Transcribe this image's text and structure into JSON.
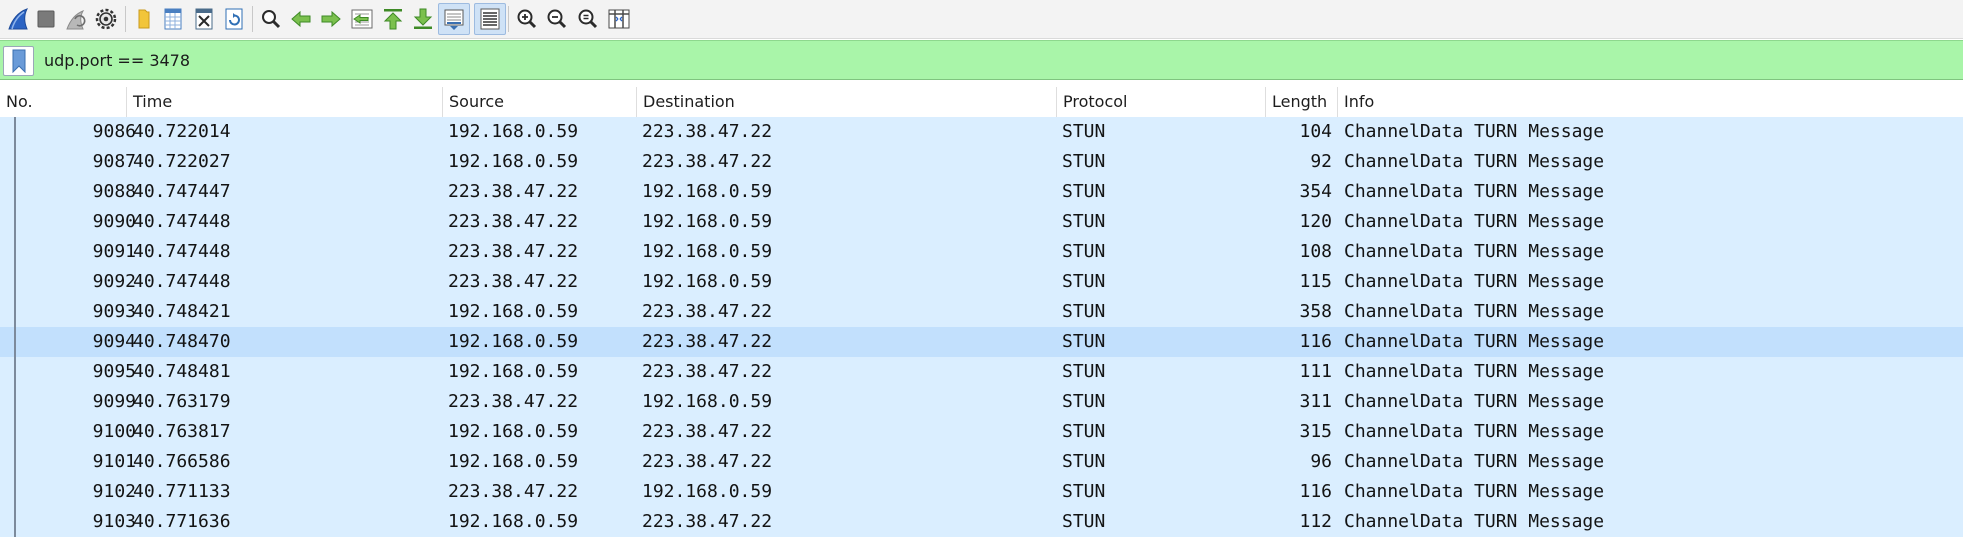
{
  "toolbar": {
    "buttons": [
      {
        "name": "start-capture-button",
        "icon": "shark-fin-icon",
        "color": "#2b63c3"
      },
      {
        "name": "stop-capture-button",
        "icon": "stop-square-icon",
        "color": "#7a7a7a"
      },
      {
        "name": "restart-capture-button",
        "icon": "restart-fin-icon",
        "color": "#9a9a9a"
      },
      {
        "name": "capture-options-button",
        "icon": "gear-icon",
        "color": "#333333"
      },
      {
        "name": "open-file-button",
        "icon": "folder-icon",
        "color": "#f2c53a"
      },
      {
        "name": "save-file-button",
        "icon": "save-grid-icon",
        "color": "#4a7fc1"
      },
      {
        "name": "close-file-button",
        "icon": "close-file-icon",
        "color": "#4a6b8a"
      },
      {
        "name": "reload-file-button",
        "icon": "reload-icon",
        "color": "#2f6fb5"
      },
      {
        "name": "find-packet-button",
        "icon": "magnifier-icon",
        "color": "#2b2b2b"
      },
      {
        "name": "go-back-button",
        "icon": "arrow-left-icon",
        "color": "#3e9c2b"
      },
      {
        "name": "go-forward-button",
        "icon": "arrow-right-icon",
        "color": "#3e9c2b"
      },
      {
        "name": "go-to-packet-button",
        "icon": "goto-packet-icon",
        "color": "#3e9c2b"
      },
      {
        "name": "first-packet-button",
        "icon": "arrow-up-bar-icon",
        "color": "#3e9c2b"
      },
      {
        "name": "last-packet-button",
        "icon": "arrow-down-bar-icon",
        "color": "#3e9c2b"
      },
      {
        "name": "autoscroll-button",
        "icon": "autoscroll-icon",
        "color": "#3a6fb0"
      },
      {
        "name": "colorize-button",
        "icon": "colorize-lines-icon",
        "color": "#444444"
      },
      {
        "name": "zoom-in-button",
        "icon": "zoom-in-icon",
        "color": "#2b2b2b"
      },
      {
        "name": "zoom-out-button",
        "icon": "zoom-out-icon",
        "color": "#2b2b2b"
      },
      {
        "name": "normal-size-button",
        "icon": "zoom-reset-icon",
        "color": "#2b2b2b"
      },
      {
        "name": "resize-columns-button",
        "icon": "resize-columns-icon",
        "color": "#2b2b2b"
      }
    ]
  },
  "filter": {
    "value": "udp.port == 3478",
    "background": "#a9f5a9"
  },
  "columns": [
    "No.",
    "Time",
    "Source",
    "Destination",
    "Protocol",
    "Length",
    "Info"
  ],
  "packets": [
    {
      "no": "9086",
      "time": "40.722014",
      "source": "192.168.0.59",
      "destination": "223.38.47.22",
      "protocol": "STUN",
      "length": "104",
      "info": "ChannelData TURN Message"
    },
    {
      "no": "9087",
      "time": "40.722027",
      "source": "192.168.0.59",
      "destination": "223.38.47.22",
      "protocol": "STUN",
      "length": "92",
      "info": "ChannelData TURN Message"
    },
    {
      "no": "9088",
      "time": "40.747447",
      "source": "223.38.47.22",
      "destination": "192.168.0.59",
      "protocol": "STUN",
      "length": "354",
      "info": "ChannelData TURN Message"
    },
    {
      "no": "9090",
      "time": "40.747448",
      "source": "223.38.47.22",
      "destination": "192.168.0.59",
      "protocol": "STUN",
      "length": "120",
      "info": "ChannelData TURN Message"
    },
    {
      "no": "9091",
      "time": "40.747448",
      "source": "223.38.47.22",
      "destination": "192.168.0.59",
      "protocol": "STUN",
      "length": "108",
      "info": "ChannelData TURN Message"
    },
    {
      "no": "9092",
      "time": "40.747448",
      "source": "223.38.47.22",
      "destination": "192.168.0.59",
      "protocol": "STUN",
      "length": "115",
      "info": "ChannelData TURN Message"
    },
    {
      "no": "9093",
      "time": "40.748421",
      "source": "192.168.0.59",
      "destination": "223.38.47.22",
      "protocol": "STUN",
      "length": "358",
      "info": "ChannelData TURN Message"
    },
    {
      "no": "9094",
      "time": "40.748470",
      "source": "192.168.0.59",
      "destination": "223.38.47.22",
      "protocol": "STUN",
      "length": "116",
      "info": "ChannelData TURN Message",
      "selected": true
    },
    {
      "no": "9095",
      "time": "40.748481",
      "source": "192.168.0.59",
      "destination": "223.38.47.22",
      "protocol": "STUN",
      "length": "111",
      "info": "ChannelData TURN Message"
    },
    {
      "no": "9099",
      "time": "40.763179",
      "source": "223.38.47.22",
      "destination": "192.168.0.59",
      "protocol": "STUN",
      "length": "311",
      "info": "ChannelData TURN Message"
    },
    {
      "no": "9100",
      "time": "40.763817",
      "source": "192.168.0.59",
      "destination": "223.38.47.22",
      "protocol": "STUN",
      "length": "315",
      "info": "ChannelData TURN Message"
    },
    {
      "no": "9101",
      "time": "40.766586",
      "source": "192.168.0.59",
      "destination": "223.38.47.22",
      "protocol": "STUN",
      "length": "96",
      "info": "ChannelData TURN Message"
    },
    {
      "no": "9102",
      "time": "40.771133",
      "source": "223.38.47.22",
      "destination": "192.168.0.59",
      "protocol": "STUN",
      "length": "116",
      "info": "ChannelData TURN Message"
    },
    {
      "no": "9103",
      "time": "40.771636",
      "source": "192.168.0.59",
      "destination": "223.38.47.22",
      "protocol": "STUN",
      "length": "112",
      "info": "ChannelData TURN Message"
    }
  ],
  "colors": {
    "row_background": "#daeeff",
    "selected_row_background": "#c2e0fd",
    "filter_valid": "#a9f5a9"
  }
}
